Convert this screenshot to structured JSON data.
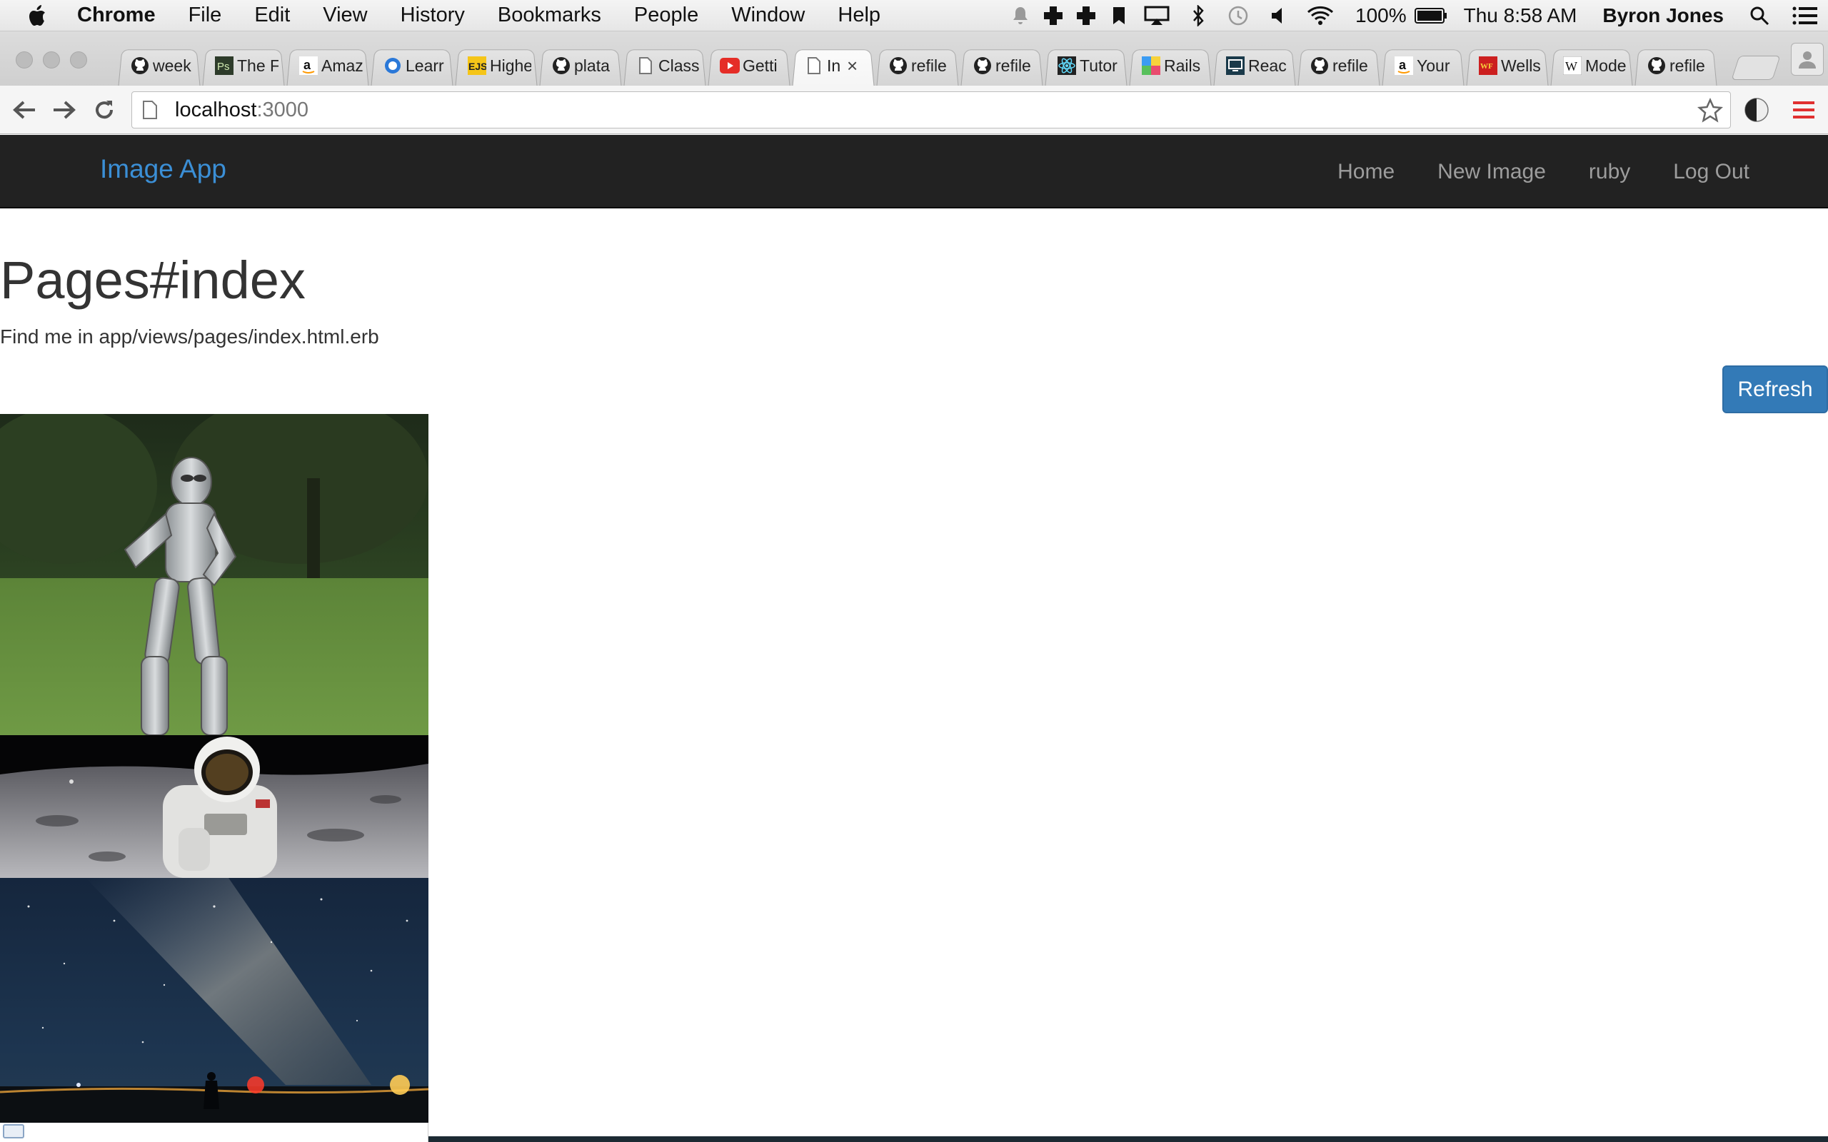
{
  "menubar": {
    "app": "Chrome",
    "items": [
      "File",
      "Edit",
      "View",
      "History",
      "Bookmarks",
      "People",
      "Window",
      "Help"
    ],
    "battery": "100%",
    "clock": "Thu 8:58 AM",
    "user": "Byron Jones"
  },
  "tabs": [
    {
      "label": "week",
      "icon": "github-icon"
    },
    {
      "label": "The F",
      "icon": "photoshop-icon"
    },
    {
      "label": "Amaz",
      "icon": "amazon-icon"
    },
    {
      "label": "Learr",
      "icon": "learn-icon"
    },
    {
      "label": "Highe",
      "icon": "ejs-icon"
    },
    {
      "label": "plata",
      "icon": "github-icon"
    },
    {
      "label": "Class",
      "icon": "page-icon"
    },
    {
      "label": "Getti",
      "icon": "youtube-icon"
    },
    {
      "label": "In",
      "icon": "page-icon",
      "active": true
    },
    {
      "label": "refile",
      "icon": "github-icon"
    },
    {
      "label": "refile",
      "icon": "github-icon"
    },
    {
      "label": "Tutor",
      "icon": "react-icon"
    },
    {
      "label": "Rails",
      "icon": "rails-icon"
    },
    {
      "label": "Reac",
      "icon": "screen-icon"
    },
    {
      "label": "refile",
      "icon": "github-icon"
    },
    {
      "label": "Your",
      "icon": "amazon-icon"
    },
    {
      "label": "Wells",
      "icon": "wellsfargo-icon"
    },
    {
      "label": "Mode",
      "icon": "wikipedia-icon"
    },
    {
      "label": "refile",
      "icon": "github-icon"
    }
  ],
  "address": {
    "host": "localhost",
    "port": ":3000"
  },
  "app_nav": {
    "brand": "Image App",
    "links": [
      "Home",
      "New Image",
      "ruby",
      "Log Out"
    ]
  },
  "page": {
    "title": "Pages#index",
    "subtitle": "Find me in app/views/pages/index.html.erb",
    "refresh_label": "Refresh"
  },
  "colors": {
    "brand": "#3b8fd6",
    "navbar_bg": "#222222",
    "button_primary": "#337ab7"
  }
}
